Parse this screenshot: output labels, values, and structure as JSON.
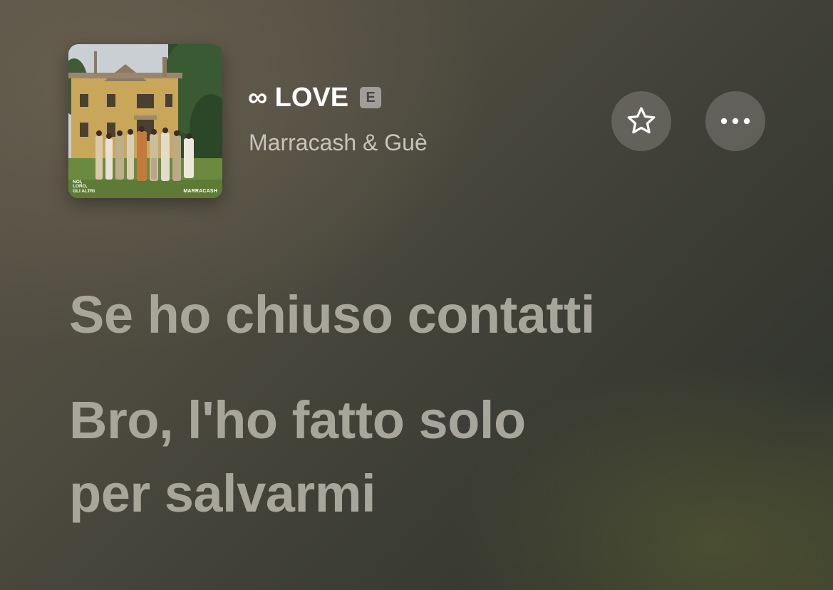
{
  "album": {
    "cover_title_text": "NOI,\nLORO,\nGLI ALTRI",
    "cover_artist_text": "MARRACASH"
  },
  "track": {
    "title": "∞ LOVE",
    "explicit_label": "E",
    "artist": "Marracash & Guè"
  },
  "actions": {
    "favorite_icon": "star-outline-icon",
    "more_icon": "ellipsis-icon"
  },
  "lyrics": [
    "Se ho chiuso contatti",
    "Bro, l'ho fatto solo",
    "per salvarmi"
  ],
  "colors": {
    "text_primary": "#ffffff",
    "text_secondary": "#c8c4bc",
    "lyric_color": "#a8a69b",
    "button_bg": "rgba(140,138,132,0.45)"
  }
}
